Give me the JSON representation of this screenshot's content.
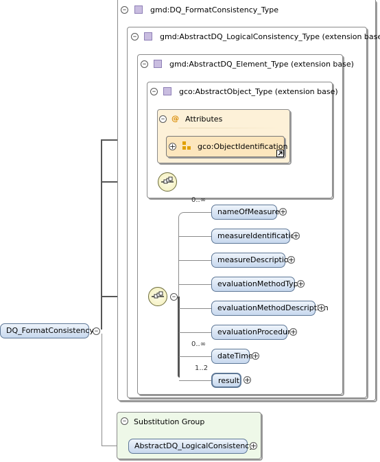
{
  "root": {
    "label": "DQ_FormatConsistency"
  },
  "types": {
    "format_consistency": "gmd:DQ_FormatConsistency_Type",
    "logical_consistency": "gmd:AbstractDQ_LogicalConsistency_Type (extension base)",
    "element_type": "gmd:AbstractDQ_Element_Type (extension base)",
    "abstract_object": "gco:AbstractObject_Type (extension base)"
  },
  "attributes": {
    "title": "Attributes",
    "at_symbol": "@",
    "attribute_group": "gco:ObjectIdentification"
  },
  "sequence": [
    {
      "label": "nameOfMeasure",
      "cardinality": "0..∞"
    },
    {
      "label": "measureIdentification",
      "cardinality": ""
    },
    {
      "label": "measureDescription",
      "cardinality": ""
    },
    {
      "label": "evaluationMethodType",
      "cardinality": ""
    },
    {
      "label": "evaluationMethodDescription",
      "cardinality": ""
    },
    {
      "label": "evaluationProcedure",
      "cardinality": ""
    },
    {
      "label": "dateTime",
      "cardinality": "0..∞"
    },
    {
      "label": "result",
      "cardinality": "1..2"
    }
  ],
  "substitution": {
    "title": "Substitution Group",
    "member": "AbstractDQ_LogicalConsistency"
  },
  "glyphs": {
    "collapse": "⊖",
    "expand": "⊕",
    "minus": "−",
    "plus": "+"
  },
  "icons": [
    "type-icon",
    "attribute-group-icon",
    "sequence-compositor-icon",
    "hyperlink-arrow-icon"
  ],
  "colors": {
    "type_icon": "#c9bde0",
    "attributes_bg": "#fdf1d8",
    "substitution_bg": "#eef8e8",
    "element_bg": "#c7d8ee",
    "element_border": "#5d7796"
  }
}
